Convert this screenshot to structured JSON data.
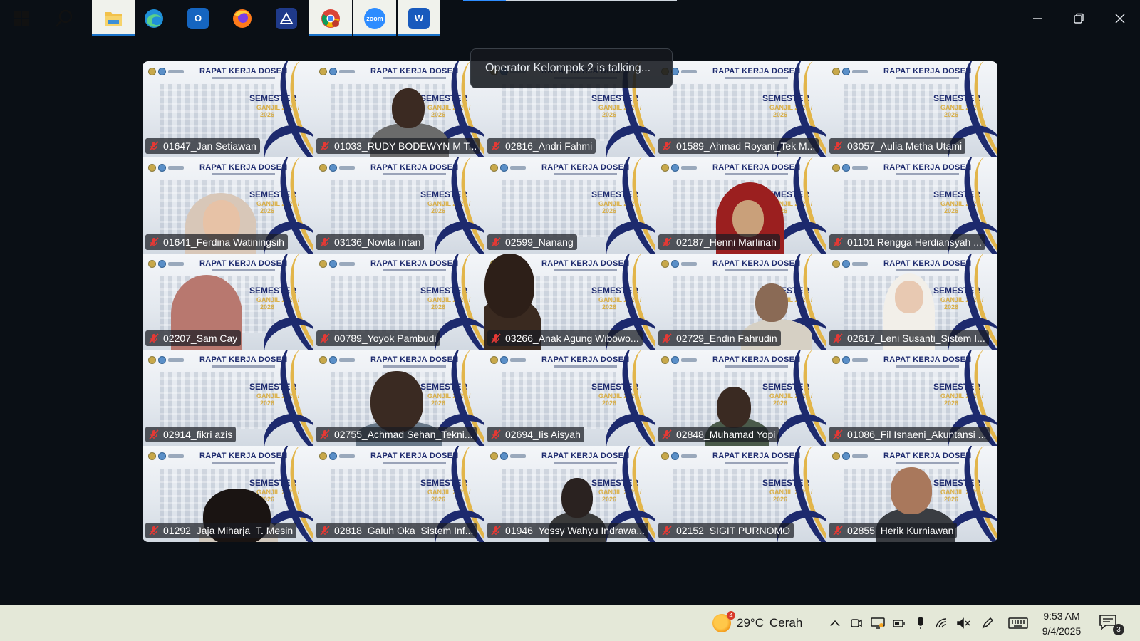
{
  "window": {
    "controls": [
      "minimize",
      "restore",
      "close"
    ]
  },
  "talking_banner": "Operator Kelompok 2 is talking...",
  "slide": {
    "title": "RAPAT KERJA DOSEN",
    "semester": "SEMESTER",
    "term": "GANJIL 2025 /",
    "year": "2026"
  },
  "participants": [
    {
      "name": "01647_Jan Setiawan",
      "video": "none"
    },
    {
      "name": "01033_RUDY BODEWYN M T...",
      "video": "man"
    },
    {
      "name": "02816_Andri Fahmi",
      "video": "none"
    },
    {
      "name": "01589_Ahmad Royani_Tek M...",
      "video": "none"
    },
    {
      "name": "03057_Aulia Metha Utami",
      "video": "none"
    },
    {
      "name": "01641_Ferdina Watiningsih",
      "video": "woman-hijab-light"
    },
    {
      "name": "03136_Novita Intan",
      "video": "none"
    },
    {
      "name": "02599_Nanang",
      "video": "none"
    },
    {
      "name": "02187_Henni Marlinah",
      "video": "woman-hijab-red"
    },
    {
      "name": "01101 Rengga Herdiansyah ...",
      "video": "none"
    },
    {
      "name": "02207_Sam Cay",
      "video": "woman-hijab-pink"
    },
    {
      "name": "00789_Yoyok Pambudi",
      "video": "none"
    },
    {
      "name": "03266_Anak Agung Wibowo...",
      "video": "man-dark"
    },
    {
      "name": "02729_Endin Fahrudin",
      "video": "man-old"
    },
    {
      "name": "02617_Leni Susanti_Sistem I...",
      "video": "woman-hijab-white"
    },
    {
      "name": "02914_fikri azis",
      "video": "none"
    },
    {
      "name": "02755_Achmad Sehan_Tekni...",
      "video": "man-glasses"
    },
    {
      "name": "02694_Iis Aisyah",
      "video": "none"
    },
    {
      "name": "02848_Muhamad Yopi",
      "video": "man-hands"
    },
    {
      "name": "01086_Fil Isnaeni_Akuntansi ...",
      "video": "none"
    },
    {
      "name": "01292_Jaja Miharja_T. Mesin",
      "video": "man-head-down"
    },
    {
      "name": "02818_Galuh Oka_Sistem Inf...",
      "video": "none"
    },
    {
      "name": "01946_Yossy Wahyu Indrawa...",
      "video": "man-young"
    },
    {
      "name": "02152_SIGIT PURNOMO",
      "video": "none"
    },
    {
      "name": "02855_Herik Kurniawan",
      "video": "man-shirt"
    }
  ],
  "taskbar": {
    "apps": [
      {
        "name": "windows-start",
        "label": "Start"
      },
      {
        "name": "search",
        "label": "Search"
      },
      {
        "name": "file-explorer",
        "label": "File Explorer"
      },
      {
        "name": "edge",
        "label": "Microsoft Edge"
      },
      {
        "name": "outlook",
        "label": "Outlook"
      },
      {
        "name": "firefox",
        "label": "Firefox"
      },
      {
        "name": "remote-app",
        "label": "App"
      },
      {
        "name": "chrome",
        "label": "Chrome"
      },
      {
        "name": "zoom",
        "label": "zoom"
      },
      {
        "name": "word",
        "label": "Word"
      }
    ],
    "weather": {
      "temp": "29°C",
      "condition": "Cerah",
      "alerts": "4"
    },
    "clock": {
      "time": "9:53 AM",
      "date": "9/4/2025"
    },
    "notifications": "3"
  },
  "colors": {
    "accent": "#2d8cff",
    "taskbar": "#e4e8d8",
    "background": "#0a0f15",
    "muted_red": "#e53935",
    "slide_navy": "#1d2a6e",
    "slide_gold": "#d9a423"
  }
}
